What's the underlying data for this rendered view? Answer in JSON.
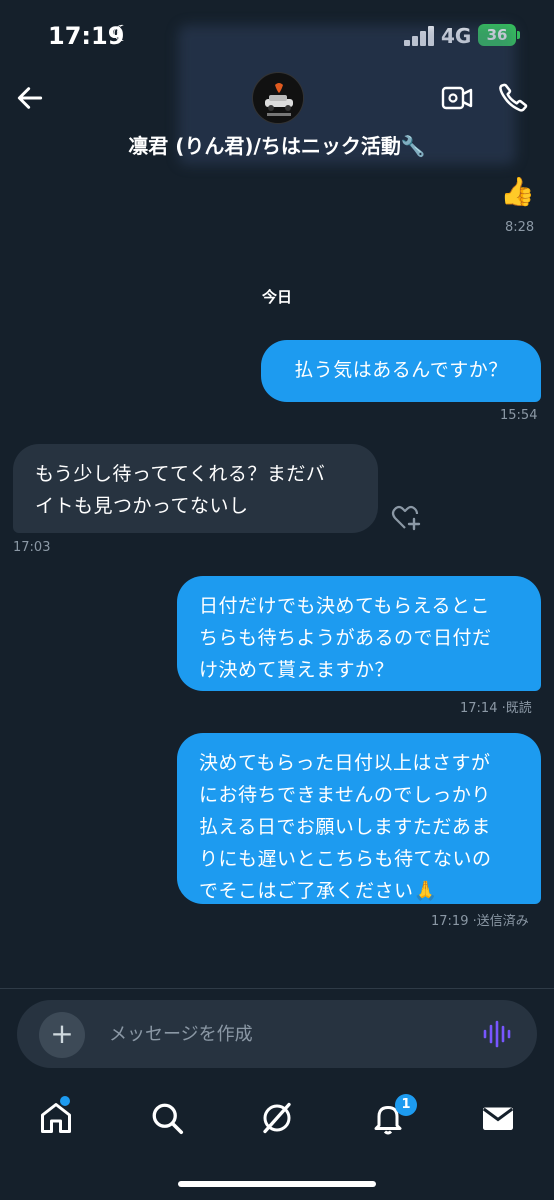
{
  "status": {
    "time": "17:19",
    "network": "4G",
    "battery": "36"
  },
  "header": {
    "contact_name": "凛君 (りん君)/ちはニック活動🔧"
  },
  "chat": {
    "earlier": {
      "emoji": "👍",
      "time": "8:28"
    },
    "day_divider": "今日",
    "messages": [
      {
        "dir": "out",
        "text": "払う気はあるんですか？",
        "meta": "15:54"
      },
      {
        "dir": "in",
        "line1": "もう少し待っててくれる？まだバ",
        "line2": "イトも見つかってないし",
        "meta": "17:03"
      },
      {
        "dir": "out",
        "line1": "日付だけでも決めてもらえるとこ",
        "line2": "ちらも待ちようがあるので日付だ",
        "line3": "け決めて貰えますか？",
        "meta": "17:14 ·既読"
      },
      {
        "dir": "out",
        "line1": "決めてもらった日付以上はさすが",
        "line2": "にお待ちできませんのでしっかり",
        "line3": "払える日でお願いしますただあま",
        "line4": "りにも遅いとこちらも待てないの",
        "line5": "でそこはご了承ください🙏",
        "meta": "17:19 ·送信済み"
      }
    ]
  },
  "composer": {
    "placeholder": "メッセージを作成"
  },
  "nav": {
    "notifications_badge": "1"
  },
  "colors": {
    "background": "#15202b",
    "outgoing_bubble": "#1d9bf0",
    "incoming_bubble": "#273340",
    "voice_accent": "#7856ff"
  }
}
